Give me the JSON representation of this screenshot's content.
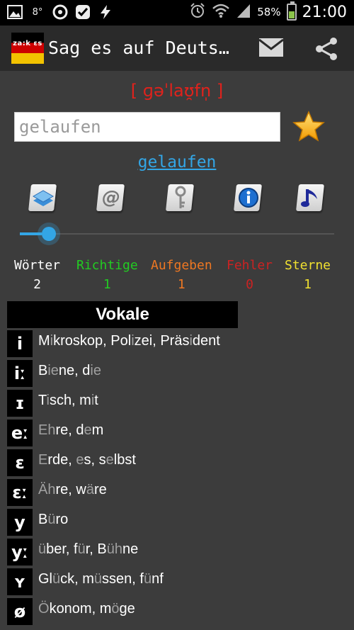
{
  "status_bar": {
    "left_icons": [
      "image-icon",
      "weather-icon",
      "app-a-icon",
      "check-icon",
      "flash-icon"
    ],
    "weather_label": "8°",
    "battery_percent": "58%",
    "battery_level": 0.58,
    "time": "21:00"
  },
  "action_bar": {
    "logo_text": "za:k ɛs",
    "title": "Sag es auf Deuts…"
  },
  "main": {
    "ipa": "[ ɡəˈlaʊ̯fn̩ ]",
    "input_value": "gelaufen",
    "input_placeholder": "gelaufen",
    "link_word": "gelaufen"
  },
  "toolbar": [
    {
      "name": "dictionary-books-icon"
    },
    {
      "name": "at-sign-icon"
    },
    {
      "name": "key-icon"
    },
    {
      "name": "info-icon"
    },
    {
      "name": "music-note-icon"
    }
  ],
  "slider_value": 0.07,
  "stats": [
    {
      "label": "Wörter",
      "value": "2",
      "color": "#ffffff"
    },
    {
      "label": "Richtige",
      "value": "1",
      "color": "#22cc22"
    },
    {
      "label": "Aufgeben",
      "value": "1",
      "color": "#ee7722"
    },
    {
      "label": "Fehler",
      "value": "0",
      "color": "#cc2222"
    },
    {
      "label": "Sterne",
      "value": "1",
      "color": "#f0e030"
    }
  ],
  "table": {
    "heading": "Vokale",
    "rows": [
      {
        "symbol": "i",
        "parts": [
          [
            "M",
            0
          ],
          [
            "i",
            1
          ],
          [
            "kroskop, Pol",
            0
          ],
          [
            "i",
            1
          ],
          [
            "zei, Präs",
            0
          ],
          [
            "i",
            1
          ],
          [
            "dent",
            0
          ]
        ]
      },
      {
        "symbol": "iː",
        "parts": [
          [
            "B",
            0
          ],
          [
            "ie",
            1
          ],
          [
            "ne, d",
            0
          ],
          [
            "ie",
            1
          ]
        ]
      },
      {
        "symbol": "ɪ",
        "parts": [
          [
            "T",
            0
          ],
          [
            "i",
            1
          ],
          [
            "sch, m",
            0
          ],
          [
            "i",
            1
          ],
          [
            "t",
            0
          ]
        ]
      },
      {
        "symbol": "eː",
        "parts": [
          [
            "Eh",
            1
          ],
          [
            "re, d",
            0
          ],
          [
            "e",
            1
          ],
          [
            "m",
            0
          ]
        ]
      },
      {
        "symbol": "ɛ",
        "parts": [
          [
            "E",
            1
          ],
          [
            "rde, ",
            0
          ],
          [
            "e",
            1
          ],
          [
            "s, s",
            0
          ],
          [
            "e",
            1
          ],
          [
            "lbst",
            0
          ]
        ]
      },
      {
        "symbol": "ɛː",
        "parts": [
          [
            "Äh",
            1
          ],
          [
            "re, w",
            0
          ],
          [
            "ä",
            1
          ],
          [
            "re",
            0
          ]
        ]
      },
      {
        "symbol": "y",
        "parts": [
          [
            "B",
            0
          ],
          [
            "ü",
            1
          ],
          [
            "ro",
            0
          ]
        ]
      },
      {
        "symbol": "yː",
        "parts": [
          [
            "ü",
            1
          ],
          [
            "ber, f",
            0
          ],
          [
            "ü",
            1
          ],
          [
            "r, B",
            0
          ],
          [
            "üh",
            1
          ],
          [
            "ne",
            0
          ]
        ]
      },
      {
        "symbol": "ʏ",
        "parts": [
          [
            "Gl",
            0
          ],
          [
            "ü",
            1
          ],
          [
            "ck, m",
            0
          ],
          [
            "ü",
            1
          ],
          [
            "ssen, f",
            0
          ],
          [
            "ü",
            1
          ],
          [
            "nf",
            0
          ]
        ]
      },
      {
        "symbol": "ø",
        "parts": [
          [
            "Ö",
            1
          ],
          [
            "konom, m",
            0
          ],
          [
            "ö",
            1
          ],
          [
            "ge",
            0
          ]
        ]
      }
    ]
  }
}
